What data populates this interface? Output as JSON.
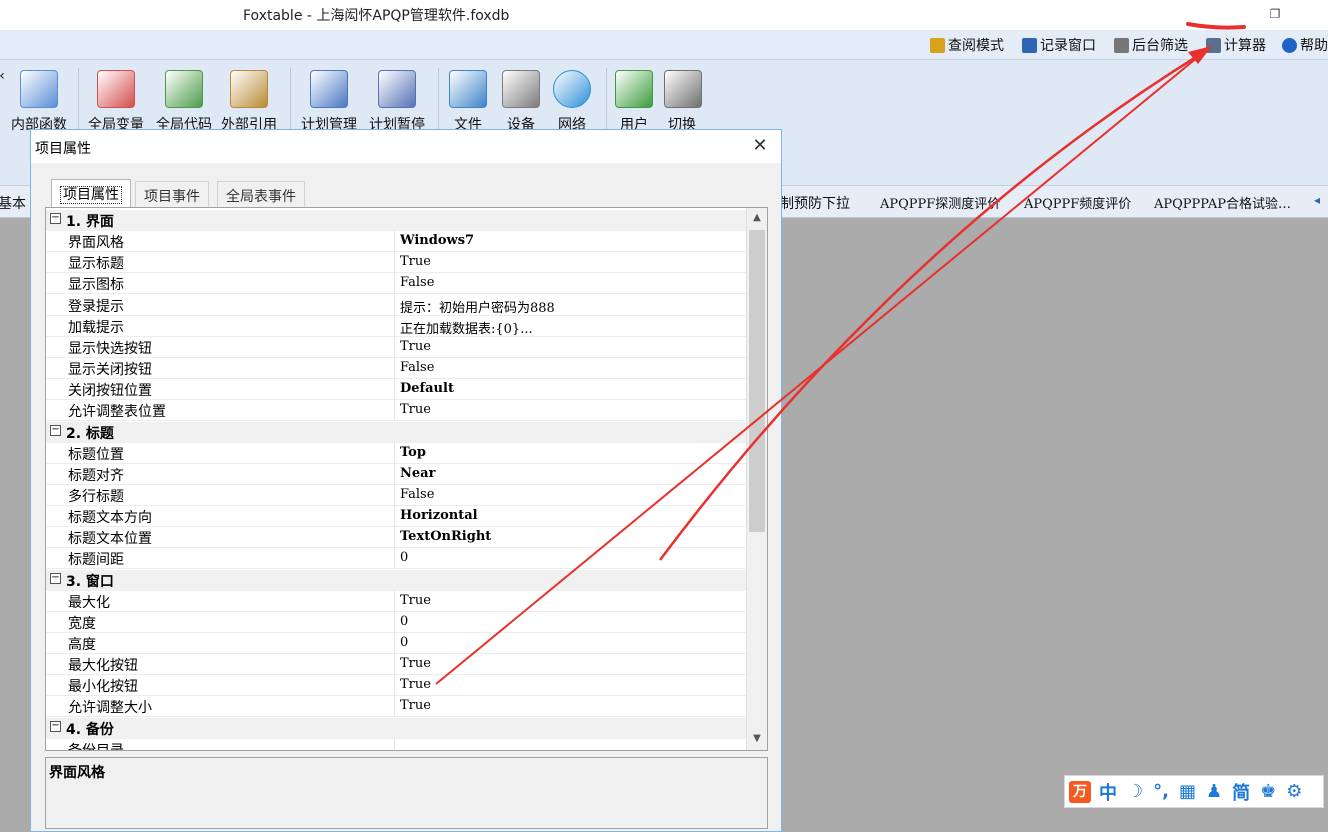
{
  "window": {
    "title": "Foxtable - 上海闳怀APQP管理软件.foxdb",
    "restore_glyph": "❐"
  },
  "toolstrip": {
    "items": [
      {
        "label": "查阅模式",
        "icon": "lock-icon",
        "color": "#d8a21c"
      },
      {
        "label": "记录窗口",
        "icon": "window-icon",
        "color": "#2f66b3"
      },
      {
        "label": "后台筛选",
        "icon": "filter-icon",
        "color": "#777777"
      },
      {
        "label": "计算器",
        "icon": "calculator-icon",
        "color": "#5b6f8c"
      },
      {
        "label": "帮助",
        "icon": "help-icon",
        "color": "#1f63c6"
      }
    ]
  },
  "ribbon": {
    "buttons": [
      {
        "label": "内部函数",
        "icon": "internal-function-icon"
      },
      {
        "label": "全局变量",
        "icon": "global-variable-icon"
      },
      {
        "label": "全局代码",
        "icon": "global-code-icon"
      },
      {
        "label": "外部引用",
        "icon": "external-reference-icon"
      },
      {
        "label": "计划管理",
        "icon": "calendar-icon"
      },
      {
        "label": "计划暂停",
        "icon": "pause-icon"
      },
      {
        "label": "文件",
        "icon": "file-icon"
      },
      {
        "label": "设备",
        "icon": "device-icon"
      },
      {
        "label": "网络",
        "icon": "globe-icon"
      },
      {
        "label": "用户",
        "icon": "users-icon"
      },
      {
        "label": "切换",
        "icon": "switch-user-icon"
      }
    ],
    "left_stub": "‹"
  },
  "tabstrip": {
    "left_label": "基本",
    "tabs": [
      "制预防下拉",
      "APQPPF探测度评价",
      "APQPPF频度评价",
      "APQPPPAP合格试验…"
    ],
    "nav_left": "◂"
  },
  "dialog": {
    "title": "项目属性",
    "close_glyph": "✕",
    "tabs": [
      "项目属性",
      "项目事件",
      "全局表事件"
    ],
    "categories": [
      {
        "name": "1. 界面",
        "props": [
          {
            "name": "界面风格",
            "value": "Windows7",
            "bold": true
          },
          {
            "name": "显示标题",
            "value": "True",
            "bold": false
          },
          {
            "name": "显示图标",
            "value": "False",
            "bold": false
          },
          {
            "name": "登录提示",
            "value": "提示：初始用户密码为888",
            "bold": false
          },
          {
            "name": "加载提示",
            "value": "正在加载数据表:{0}...",
            "bold": false
          },
          {
            "name": "显示快选按钮",
            "value": "True",
            "bold": false
          },
          {
            "name": "显示关闭按钮",
            "value": "False",
            "bold": false
          },
          {
            "name": "关闭按钮位置",
            "value": "Default",
            "bold": true
          },
          {
            "name": "允许调整表位置",
            "value": "True",
            "bold": false
          }
        ]
      },
      {
        "name": "2. 标题",
        "props": [
          {
            "name": "标题位置",
            "value": "Top",
            "bold": true
          },
          {
            "name": "标题对齐",
            "value": "Near",
            "bold": true
          },
          {
            "name": "多行标题",
            "value": "False",
            "bold": false
          },
          {
            "name": "标题文本方向",
            "value": "Horizontal",
            "bold": true
          },
          {
            "name": "标题文本位置",
            "value": "TextOnRight",
            "bold": true
          },
          {
            "name": "标题间距",
            "value": "0",
            "bold": false
          }
        ]
      },
      {
        "name": "3. 窗口",
        "props": [
          {
            "name": "最大化",
            "value": "True",
            "bold": false
          },
          {
            "name": "宽度",
            "value": "0",
            "bold": false
          },
          {
            "name": "高度",
            "value": "0",
            "bold": false
          },
          {
            "name": "最大化按钮",
            "value": "True",
            "bold": false
          },
          {
            "name": "最小化按钮",
            "value": "True",
            "bold": false
          },
          {
            "name": "允许调整大小",
            "value": "True",
            "bold": false
          }
        ]
      },
      {
        "name": "4. 备份",
        "props": [
          {
            "name": "备份目录",
            "value": "",
            "bold": false
          }
        ]
      }
    ],
    "scroll_up": "▲",
    "scroll_down": "▼",
    "description_title": "界面风格"
  },
  "ime": {
    "logo": "万",
    "items": [
      "中",
      "☽",
      "°,",
      "▦",
      "♟",
      "简",
      "♚",
      "⚙"
    ]
  },
  "colors": {
    "annotation_red": "#e8302c",
    "ribbon_bg": "#dfe8f5",
    "workspace_bg": "#ababab"
  }
}
